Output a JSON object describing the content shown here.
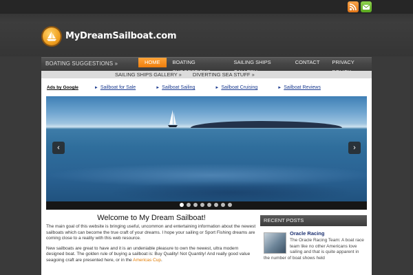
{
  "site": {
    "title": "MyDreamSailboat.com"
  },
  "social": {
    "rss_icon": "rss-icon",
    "mail_icon": "email-icon"
  },
  "nav": {
    "left_label": "BOATING SUGGESTIONS »",
    "items": [
      {
        "label": "HOME",
        "active": true
      },
      {
        "label": "BOATING SUGGESTIONS"
      },
      {
        "label": "SAILING SHIPS GALLERY"
      },
      {
        "label": "CONTACT"
      },
      {
        "label": "PRIVACY POLICY"
      }
    ]
  },
  "subnav": {
    "items": [
      "SAILING SHIPS GALLERY »",
      "DIVERTING SEA STUFF »"
    ]
  },
  "ads": {
    "label": "Ads by Google",
    "links": [
      "Sailboat for Sale",
      "Sailboat Sailing",
      "Sailboat Cruising",
      "Sailboat Reviews"
    ]
  },
  "slider": {
    "prev": "‹",
    "next": "›",
    "dot_count": 8,
    "active_index": 0
  },
  "main": {
    "heading": "Welcome to My Dream Sailboat!",
    "para1": "The main goal of this website is bringing useful, uncommon and entertaining information about the newest sailboats which can become the true craft of your dreams. I hope your sailing or Sport Fishing dreams are coming close to a reality with this web resource.",
    "para2_pre": "New sailboats are great to have and it is an undeniable pleasure to own the newest, ultra modern designed boat. The golden rule of buying a sailboat is: Buy Quality! Not Quantity! And really good value seagoing craft are presented here, or in the ",
    "para2_link": "Americas Cup",
    "para2_post": "."
  },
  "sidebar": {
    "header": "RECENT POSTS",
    "post": {
      "title": "Oracle Racing",
      "text": "The Oracle Racing Team: A boat race team like no other Americans love sailing and that is quite apparent in",
      "text2": "the number of boat shows held"
    }
  },
  "colors": {
    "accent": "#ee7d0c",
    "link": "#1a3a90",
    "header_bg": "#2b2b2b"
  }
}
